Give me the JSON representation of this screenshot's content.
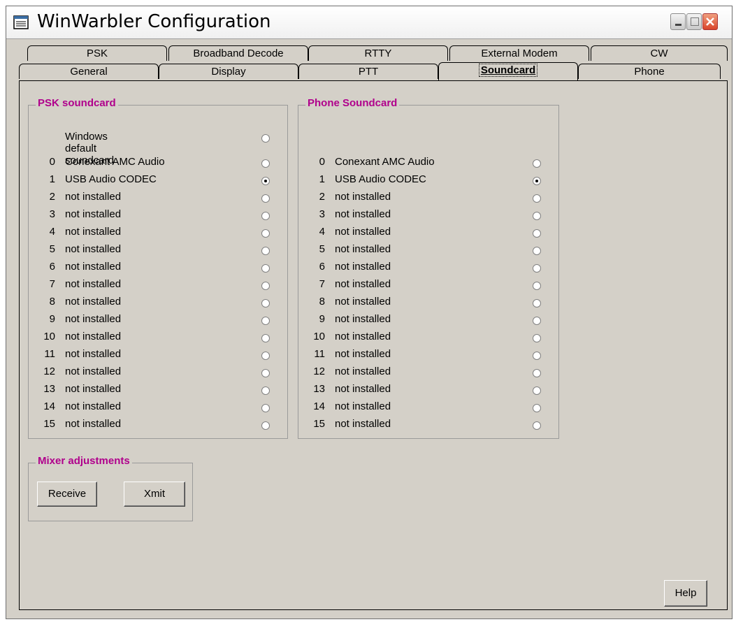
{
  "window": {
    "title": "WinWarbler Configuration"
  },
  "tabs_back": [
    "PSK",
    "Broadband Decode",
    "RTTY",
    "External Modem",
    "CW"
  ],
  "tabs_front": [
    "General",
    "Display",
    "PTT",
    "Soundcard",
    "Phone"
  ],
  "active_tab": "Soundcard",
  "psk": {
    "title": "PSK soundcard",
    "default_label": "Windows default soundcard",
    "devices": [
      {
        "idx": "0",
        "name": "Conexant AMC Audio",
        "selected": false
      },
      {
        "idx": "1",
        "name": "USB Audio CODEC",
        "selected": true
      },
      {
        "idx": "2",
        "name": "not installed",
        "selected": false
      },
      {
        "idx": "3",
        "name": "not installed",
        "selected": false
      },
      {
        "idx": "4",
        "name": "not installed",
        "selected": false
      },
      {
        "idx": "5",
        "name": "not installed",
        "selected": false
      },
      {
        "idx": "6",
        "name": "not installed",
        "selected": false
      },
      {
        "idx": "7",
        "name": "not installed",
        "selected": false
      },
      {
        "idx": "8",
        "name": "not installed",
        "selected": false
      },
      {
        "idx": "9",
        "name": "not installed",
        "selected": false
      },
      {
        "idx": "10",
        "name": "not installed",
        "selected": false
      },
      {
        "idx": "11",
        "name": "not installed",
        "selected": false
      },
      {
        "idx": "12",
        "name": "not installed",
        "selected": false
      },
      {
        "idx": "13",
        "name": "not installed",
        "selected": false
      },
      {
        "idx": "14",
        "name": "not installed",
        "selected": false
      },
      {
        "idx": "15",
        "name": "not installed",
        "selected": false
      }
    ]
  },
  "phone": {
    "title": "Phone Soundcard",
    "devices": [
      {
        "idx": "0",
        "name": "Conexant AMC Audio",
        "selected": false
      },
      {
        "idx": "1",
        "name": "USB Audio CODEC",
        "selected": true
      },
      {
        "idx": "2",
        "name": "not installed",
        "selected": false
      },
      {
        "idx": "3",
        "name": "not installed",
        "selected": false
      },
      {
        "idx": "4",
        "name": "not installed",
        "selected": false
      },
      {
        "idx": "5",
        "name": "not installed",
        "selected": false
      },
      {
        "idx": "6",
        "name": "not installed",
        "selected": false
      },
      {
        "idx": "7",
        "name": "not installed",
        "selected": false
      },
      {
        "idx": "8",
        "name": "not installed",
        "selected": false
      },
      {
        "idx": "9",
        "name": "not installed",
        "selected": false
      },
      {
        "idx": "10",
        "name": "not installed",
        "selected": false
      },
      {
        "idx": "11",
        "name": "not installed",
        "selected": false
      },
      {
        "idx": "12",
        "name": "not installed",
        "selected": false
      },
      {
        "idx": "13",
        "name": "not installed",
        "selected": false
      },
      {
        "idx": "14",
        "name": "not installed",
        "selected": false
      },
      {
        "idx": "15",
        "name": "not installed",
        "selected": false
      }
    ]
  },
  "mixer": {
    "title": "Mixer adjustments",
    "receive_label": "Receive",
    "xmit_label": "Xmit"
  },
  "help_label": "Help",
  "colors": {
    "group_title": "#b0008c",
    "face": "#d4d0c8"
  },
  "icons": {
    "app": "notepad-icon",
    "minimize": "minimize-icon",
    "maximize": "maximize-icon",
    "close": "close-icon"
  }
}
